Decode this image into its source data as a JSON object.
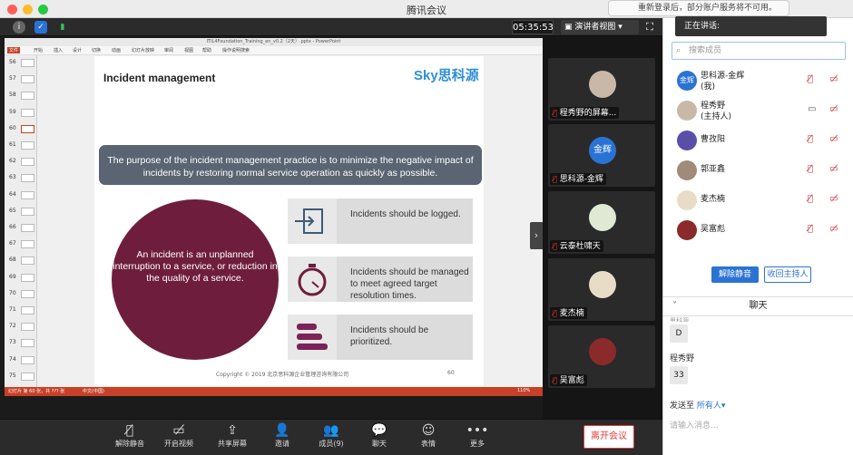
{
  "window": {
    "title": "腾讯会议"
  },
  "toolbar": {
    "timer": "05:35:53",
    "view_label": "演讲者视图"
  },
  "toast": {
    "text": "重新登录后，部分账户服务将不可用。"
  },
  "ppt": {
    "file_title": "ITIL4Foundation_Training_en_v0.2（2天）.pptx - PowerPoint",
    "ribbon": [
      "文件",
      "开始",
      "插入",
      "设计",
      "切换",
      "动画",
      "幻灯片放映",
      "审阅",
      "视图",
      "帮助",
      "操作说明搜索"
    ],
    "thumb_numbers": [
      "56",
      "57",
      "58",
      "59",
      "60",
      "61",
      "62",
      "63",
      "64",
      "65",
      "66",
      "67",
      "68",
      "69",
      "70",
      "71",
      "72",
      "73",
      "74",
      "75"
    ],
    "status_left": "幻灯片 第 60 张，共 ??? 张",
    "status_lang": "中文(中国)",
    "zoom": "110%"
  },
  "slide": {
    "title": "Incident management",
    "logo_text": "Sky思科源",
    "purpose": "The purpose of the incident management practice is to minimize the negative impact of incidents by restoring normal service operation as quickly as possible.",
    "circle_text": "An incident is an unplanned interruption to a service, or reduction in the quality of a service.",
    "boxes": [
      "Incidents should be logged.",
      "Incidents should be managed to meet agreed target resolution times.",
      "Incidents should be prioritized."
    ],
    "copyright": "Copyright © 2019 北京思科源企业管理咨询有限公司",
    "page_number": "60"
  },
  "videos": [
    {
      "name": "程秀野的屏幕..."
    },
    {
      "name": "思科源-金辉",
      "avatar_text": "金辉"
    },
    {
      "name": "云泰杜啸天"
    },
    {
      "name": "麦杰楠"
    },
    {
      "name": "吴富彪"
    }
  ],
  "bottombar": {
    "buttons": [
      "解除静音",
      "开启视频",
      "共享屏幕",
      "邀请",
      "成员(9)",
      "聊天",
      "表情",
      "更多"
    ],
    "leave": "离开会议"
  },
  "panel": {
    "speaking_label": "正在讲话:",
    "search_placeholder": "搜索成员",
    "participants": [
      {
        "name": "思科源-金辉",
        "role": "(我)",
        "avatar_text": "金辉"
      },
      {
        "name": "程秀野",
        "role": "(主持人)"
      },
      {
        "name": "曹孜阳",
        "role": ""
      },
      {
        "name": "郭亚鑫",
        "role": ""
      },
      {
        "name": "麦杰楠",
        "role": ""
      },
      {
        "name": "吴富彪",
        "role": ""
      }
    ],
    "unmute_label": "解除静音",
    "reclaim_host_label": "收回主持人",
    "chat_header": "聊天",
    "chat_prev_sender": "思科源",
    "chat_msgs": [
      {
        "text": "D"
      },
      {
        "sender": "程秀野",
        "text": "33"
      }
    ],
    "send_to_label": "发送至",
    "send_to_value": "所有人",
    "chat_placeholder": "请输入消息..."
  },
  "colors": {
    "accent": "#2a73d4",
    "slide_circle": "#6e1e3c",
    "ppt_red": "#c64127",
    "leave_red": "#e03b3b"
  }
}
